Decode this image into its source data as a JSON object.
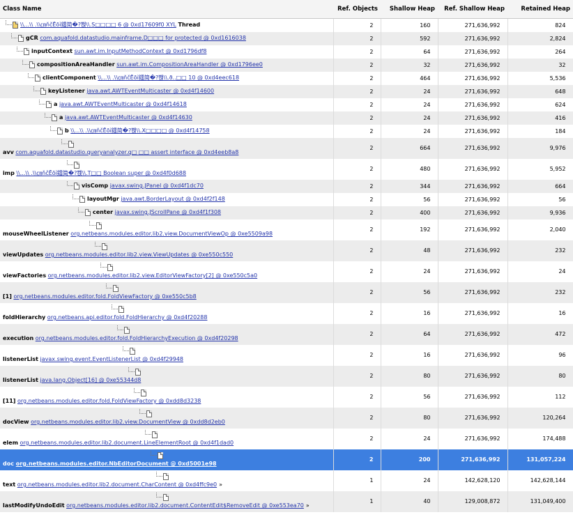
{
  "columns": [
    "Class Name",
    "Ref. Objects",
    "Shallow Heap",
    "Ref. Shallow Heap",
    "Retained Heap"
  ],
  "rows": [
    {
      "indent": 0,
      "field": "",
      "cls": "\\\\...\\\\ .\\\\㎝ňčĒ̈ōỉ鐳简�?뽽\\\\.S□□□□ 6 @ 0xd17609f0 XYL",
      "suffix": "Thread",
      "ref": "2",
      "shallow": "160",
      "refShallow": "271,636,992",
      "retained": "824",
      "tall": false,
      "selected": false,
      "more": ""
    },
    {
      "indent": 1,
      "field": "gCR",
      "cls": "com.aquafold.datastudio.mainframe.D□□□ for protected @ 0xd1616038",
      "suffix": "",
      "ref": "2",
      "shallow": "592",
      "refShallow": "271,636,992",
      "retained": "2,824",
      "tall": false,
      "selected": false,
      "more": ""
    },
    {
      "indent": 2,
      "field": "inputContext",
      "cls": "sun.awt.im.InputMethodContext @ 0xd1796df8",
      "suffix": "",
      "ref": "2",
      "shallow": "64",
      "refShallow": "271,636,992",
      "retained": "264",
      "tall": false,
      "selected": false,
      "more": ""
    },
    {
      "indent": 3,
      "field": "compositionAreaHandler",
      "cls": "sun.awt.im.CompositionAreaHandler @ 0xd1796ee0",
      "suffix": "",
      "ref": "2",
      "shallow": "32",
      "refShallow": "271,636,992",
      "retained": "32",
      "tall": false,
      "selected": false,
      "more": ""
    },
    {
      "indent": 4,
      "field": "clientComponent",
      "cls": "\\\\...\\\\ .\\\\㎝ňčĒ̈ōỉ鐳简�?뽽\\\\.ϑ..□□ 10 @ 0xd4eec618",
      "suffix": "",
      "ref": "2",
      "shallow": "464",
      "refShallow": "271,636,992",
      "retained": "5,536",
      "tall": false,
      "selected": false,
      "more": ""
    },
    {
      "indent": 5,
      "field": "keyListener",
      "cls": "java.awt.AWTEventMulticaster @ 0xd4f14600",
      "suffix": "",
      "ref": "2",
      "shallow": "24",
      "refShallow": "271,636,992",
      "retained": "648",
      "tall": false,
      "selected": false,
      "more": ""
    },
    {
      "indent": 6,
      "field": "a",
      "cls": "java.awt.AWTEventMulticaster @ 0xd4f14618",
      "suffix": "",
      "ref": "2",
      "shallow": "24",
      "refShallow": "271,636,992",
      "retained": "624",
      "tall": false,
      "selected": false,
      "more": ""
    },
    {
      "indent": 7,
      "field": "a",
      "cls": "java.awt.AWTEventMulticaster @ 0xd4f14630",
      "suffix": "",
      "ref": "2",
      "shallow": "24",
      "refShallow": "271,636,992",
      "retained": "416",
      "tall": false,
      "selected": false,
      "more": ""
    },
    {
      "indent": 8,
      "field": "b",
      "cls": "\\\\...\\\\ .\\\\㎝ňčĒ̈ōỉ鐳简�?뽽\\\\.X□□□□ @ 0xd4f14758",
      "suffix": "",
      "ref": "2",
      "shallow": "24",
      "refShallow": "271,636,992",
      "retained": "184",
      "tall": false,
      "selected": false,
      "more": ""
    },
    {
      "indent": 9,
      "field": "avv",
      "cls": "com.aquafold.datastudio.queryanalyzer.q□ □□ assert interface @ 0xd4eeb8a8",
      "suffix": "",
      "ref": "2",
      "shallow": "664",
      "refShallow": "271,636,992",
      "retained": "9,976",
      "tall": true,
      "selected": false,
      "more": ""
    },
    {
      "indent": 10,
      "field": "imp",
      "cls": "\\\\...\\\\ .\\\\㎝ňčĒ̈ōỉ鐳简�?뽽\\\\.T□□ Boolean super @ 0xd4f0d688",
      "suffix": "",
      "ref": "2",
      "shallow": "480",
      "refShallow": "271,636,992",
      "retained": "5,952",
      "tall": true,
      "selected": false,
      "more": ""
    },
    {
      "indent": 11,
      "field": "visComp",
      "cls": "javax.swing.JPanel @ 0xd4f1dc70",
      "suffix": "",
      "ref": "2",
      "shallow": "344",
      "refShallow": "271,636,992",
      "retained": "664",
      "tall": false,
      "selected": false,
      "more": ""
    },
    {
      "indent": 12,
      "field": "layoutMgr",
      "cls": "java.awt.BorderLayout @ 0xd4f2f148",
      "suffix": "",
      "ref": "2",
      "shallow": "56",
      "refShallow": "271,636,992",
      "retained": "56",
      "tall": false,
      "selected": false,
      "more": ""
    },
    {
      "indent": 13,
      "field": "center",
      "cls": "javax.swing.JScrollPane @ 0xd4f1f308",
      "suffix": "",
      "ref": "2",
      "shallow": "400",
      "refShallow": "271,636,992",
      "retained": "9,936",
      "tall": false,
      "selected": false,
      "more": ""
    },
    {
      "indent": 14,
      "field": "mouseWheelListener",
      "cls": "org.netbeans.modules.editor.lib2.view.DocumentViewOp @ 0xe5509a98",
      "suffix": "",
      "ref": "2",
      "shallow": "192",
      "refShallow": "271,636,992",
      "retained": "2,040",
      "tall": true,
      "selected": false,
      "more": ""
    },
    {
      "indent": 15,
      "field": "viewUpdates",
      "cls": "org.netbeans.modules.editor.lib2.view.ViewUpdates @ 0xe550c550",
      "suffix": "",
      "ref": "2",
      "shallow": "48",
      "refShallow": "271,636,992",
      "retained": "232",
      "tall": true,
      "selected": false,
      "more": ""
    },
    {
      "indent": 16,
      "field": "viewFactories",
      "cls": "org.netbeans.modules.editor.lib2.view.EditorViewFactory[2] @ 0xe550c5a0",
      "suffix": "",
      "ref": "2",
      "shallow": "24",
      "refShallow": "271,636,992",
      "retained": "24",
      "tall": true,
      "selected": false,
      "more": ""
    },
    {
      "indent": 17,
      "field": "[1]",
      "cls": "org.netbeans.modules.editor.fold.FoldViewFactory @ 0xe550c5b8",
      "suffix": "",
      "ref": "2",
      "shallow": "56",
      "refShallow": "271,636,992",
      "retained": "232",
      "tall": true,
      "selected": false,
      "more": ""
    },
    {
      "indent": 18,
      "field": "foldHierarchy",
      "cls": "org.netbeans.api.editor.fold.FoldHierarchy @ 0xd4f20288",
      "suffix": "",
      "ref": "2",
      "shallow": "16",
      "refShallow": "271,636,992",
      "retained": "16",
      "tall": true,
      "selected": false,
      "more": ""
    },
    {
      "indent": 19,
      "field": "execution",
      "cls": "org.netbeans.modules.editor.fold.FoldHierarchyExecution @ 0xd4f20298",
      "suffix": "",
      "ref": "2",
      "shallow": "64",
      "refShallow": "271,636,992",
      "retained": "472",
      "tall": true,
      "selected": false,
      "more": ""
    },
    {
      "indent": 20,
      "field": "listenerList",
      "cls": "javax.swing.event.EventListenerList @ 0xd4f29948",
      "suffix": "",
      "ref": "2",
      "shallow": "16",
      "refShallow": "271,636,992",
      "retained": "96",
      "tall": true,
      "selected": false,
      "more": ""
    },
    {
      "indent": 21,
      "field": "listenerList",
      "cls": "java.lang.Object[16] @ 0xe55344d8",
      "suffix": "",
      "ref": "2",
      "shallow": "80",
      "refShallow": "271,636,992",
      "retained": "80",
      "tall": true,
      "selected": false,
      "more": ""
    },
    {
      "indent": 22,
      "field": "[11]",
      "cls": "org.netbeans.modules.editor.fold.FoldViewFactory @ 0xdd8d3238",
      "suffix": "",
      "ref": "2",
      "shallow": "56",
      "refShallow": "271,636,992",
      "retained": "112",
      "tall": true,
      "selected": false,
      "more": ""
    },
    {
      "indent": 23,
      "field": "docView",
      "cls": "org.netbeans.modules.editor.lib2.view.DocumentView @ 0xdd8d2eb0",
      "suffix": "",
      "ref": "2",
      "shallow": "80",
      "refShallow": "271,636,992",
      "retained": "120,264",
      "tall": true,
      "selected": false,
      "more": ""
    },
    {
      "indent": 24,
      "field": "elem",
      "cls": "org.netbeans.modules.editor.lib2.document.LineElementRoot @ 0xd4f1dad0",
      "suffix": "",
      "ref": "2",
      "shallow": "24",
      "refShallow": "271,636,992",
      "retained": "174,488",
      "tall": true,
      "selected": false,
      "more": ""
    },
    {
      "indent": 25,
      "field": "doc",
      "cls": "org.netbeans.modules.editor.NbEditorDocument @ 0xd5001e98",
      "suffix": "",
      "ref": "2",
      "shallow": "200",
      "refShallow": "271,636,992",
      "retained": "131,057,224",
      "tall": true,
      "selected": true,
      "more": ""
    },
    {
      "indent": 26,
      "field": "text",
      "cls": "org.netbeans.modules.editor.lib2.document.CharContent @ 0xd4ffc9e0",
      "suffix": "",
      "ref": "1",
      "shallow": "24",
      "refShallow": "142,628,120",
      "retained": "142,628,144",
      "tall": true,
      "selected": false,
      "more": "»"
    },
    {
      "indent": 26,
      "field": "lastModifyUndoEdit",
      "cls": "org.netbeans.modules.editor.lib2.document.ContentEdit$RemoveEdit @ 0xe553ea70",
      "suffix": "",
      "ref": "1",
      "shallow": "40",
      "refShallow": "129,008,872",
      "retained": "131,049,400",
      "tall": true,
      "selected": false,
      "more": "»"
    }
  ]
}
